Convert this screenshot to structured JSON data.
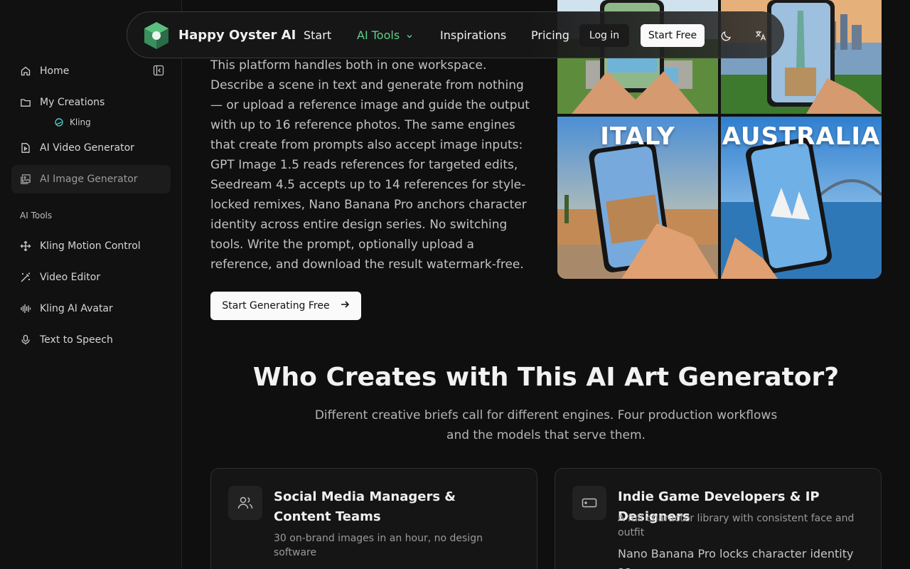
{
  "sidebar": {
    "items": [
      {
        "label": "Home",
        "icon": "home-icon"
      },
      {
        "label": "My Creations",
        "icon": "folder-icon"
      },
      {
        "label": "AI Video Generator",
        "icon": "video-file-icon"
      },
      {
        "label": "AI Image Generator",
        "icon": "image-icon"
      },
      {
        "label": "Kling Motion Control",
        "icon": "move-icon"
      },
      {
        "label": "Video Editor",
        "icon": "magic-wand-icon"
      },
      {
        "label": "Kling AI Avatar",
        "icon": "audio-wave-icon"
      },
      {
        "label": "Text to Speech",
        "icon": "microphone-icon"
      }
    ],
    "sub_item": "Kling",
    "section_label": "AI Tools"
  },
  "nav": {
    "brand": "Happy Oyster AI",
    "links": [
      "Start",
      "AI Tools",
      "Inspirations",
      "Pricing"
    ],
    "login": "Log in",
    "start_free": "Start Free",
    "accent": "#5fd08a"
  },
  "main": {
    "paragraph": "This platform handles both in one workspace. Describe a scene in text and generate from nothing — or upload a reference image and guide the output with up to 16 reference photos. The same engines that create from prompts also accept image inputs: GPT Image 1.5 reads references for targeted edits, Seedream 4.5 accepts up to 14 references for style-locked remixes, Nano Banana Pro anchors character identity across entire design series. No switching tools. Write the prompt, optionally upload a reference, and download the result watermark-free.",
    "cta": "Start Generating Free"
  },
  "gallery": {
    "labels": [
      "ITALY",
      "AUSTRALIA"
    ]
  },
  "section": {
    "title": "Who Creates with This AI Art Generator?",
    "subtitle": "Different creative briefs call for different engines. Four production workflows and the models that serve them.",
    "cards": [
      {
        "icon": "users-icon",
        "title": "Social Media Managers & Content Teams",
        "desc": "30 on-brand images in an hour, no design software",
        "body": ""
      },
      {
        "icon": "gamepad-icon",
        "title": "Indie Game Developers & IP Designers",
        "desc": "A full character library with consistent face and outfit",
        "body": "Nano Banana Pro locks character identity as"
      }
    ]
  }
}
